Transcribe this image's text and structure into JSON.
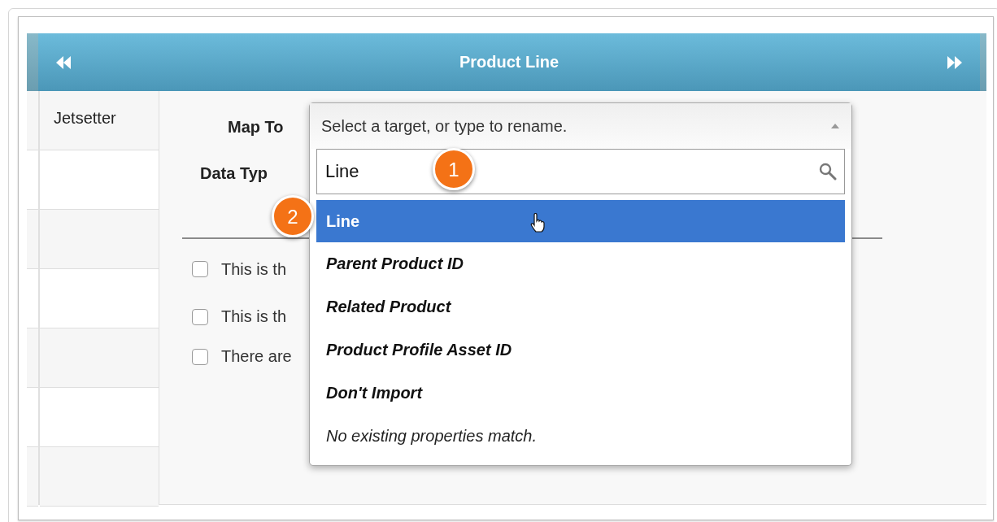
{
  "header": {
    "title": "Product Line"
  },
  "first_column": {
    "cells": [
      "Jetsetter"
    ]
  },
  "form": {
    "map_to_label": "Map To",
    "data_type_label": "Data Typ",
    "checkboxes": [
      {
        "label": "This is th",
        "checked": false
      },
      {
        "label": "This is th",
        "checked": false
      },
      {
        "label": "There are",
        "checked": false
      }
    ]
  },
  "dropdown": {
    "placeholder": "Select a target, or type to rename.",
    "expanded": true,
    "search": {
      "value": "Line"
    },
    "options": [
      {
        "label": "Line",
        "kind": "option",
        "selected": true
      },
      {
        "label": "Parent Product ID",
        "kind": "option",
        "selected": false
      },
      {
        "label": "Related Product",
        "kind": "option",
        "selected": false
      },
      {
        "label": "Product Profile Asset ID",
        "kind": "option",
        "selected": false
      },
      {
        "label": "Don't Import",
        "kind": "option",
        "selected": false
      },
      {
        "label": "No existing properties match.",
        "kind": "note"
      }
    ]
  },
  "callouts": [
    "1",
    "2"
  ]
}
